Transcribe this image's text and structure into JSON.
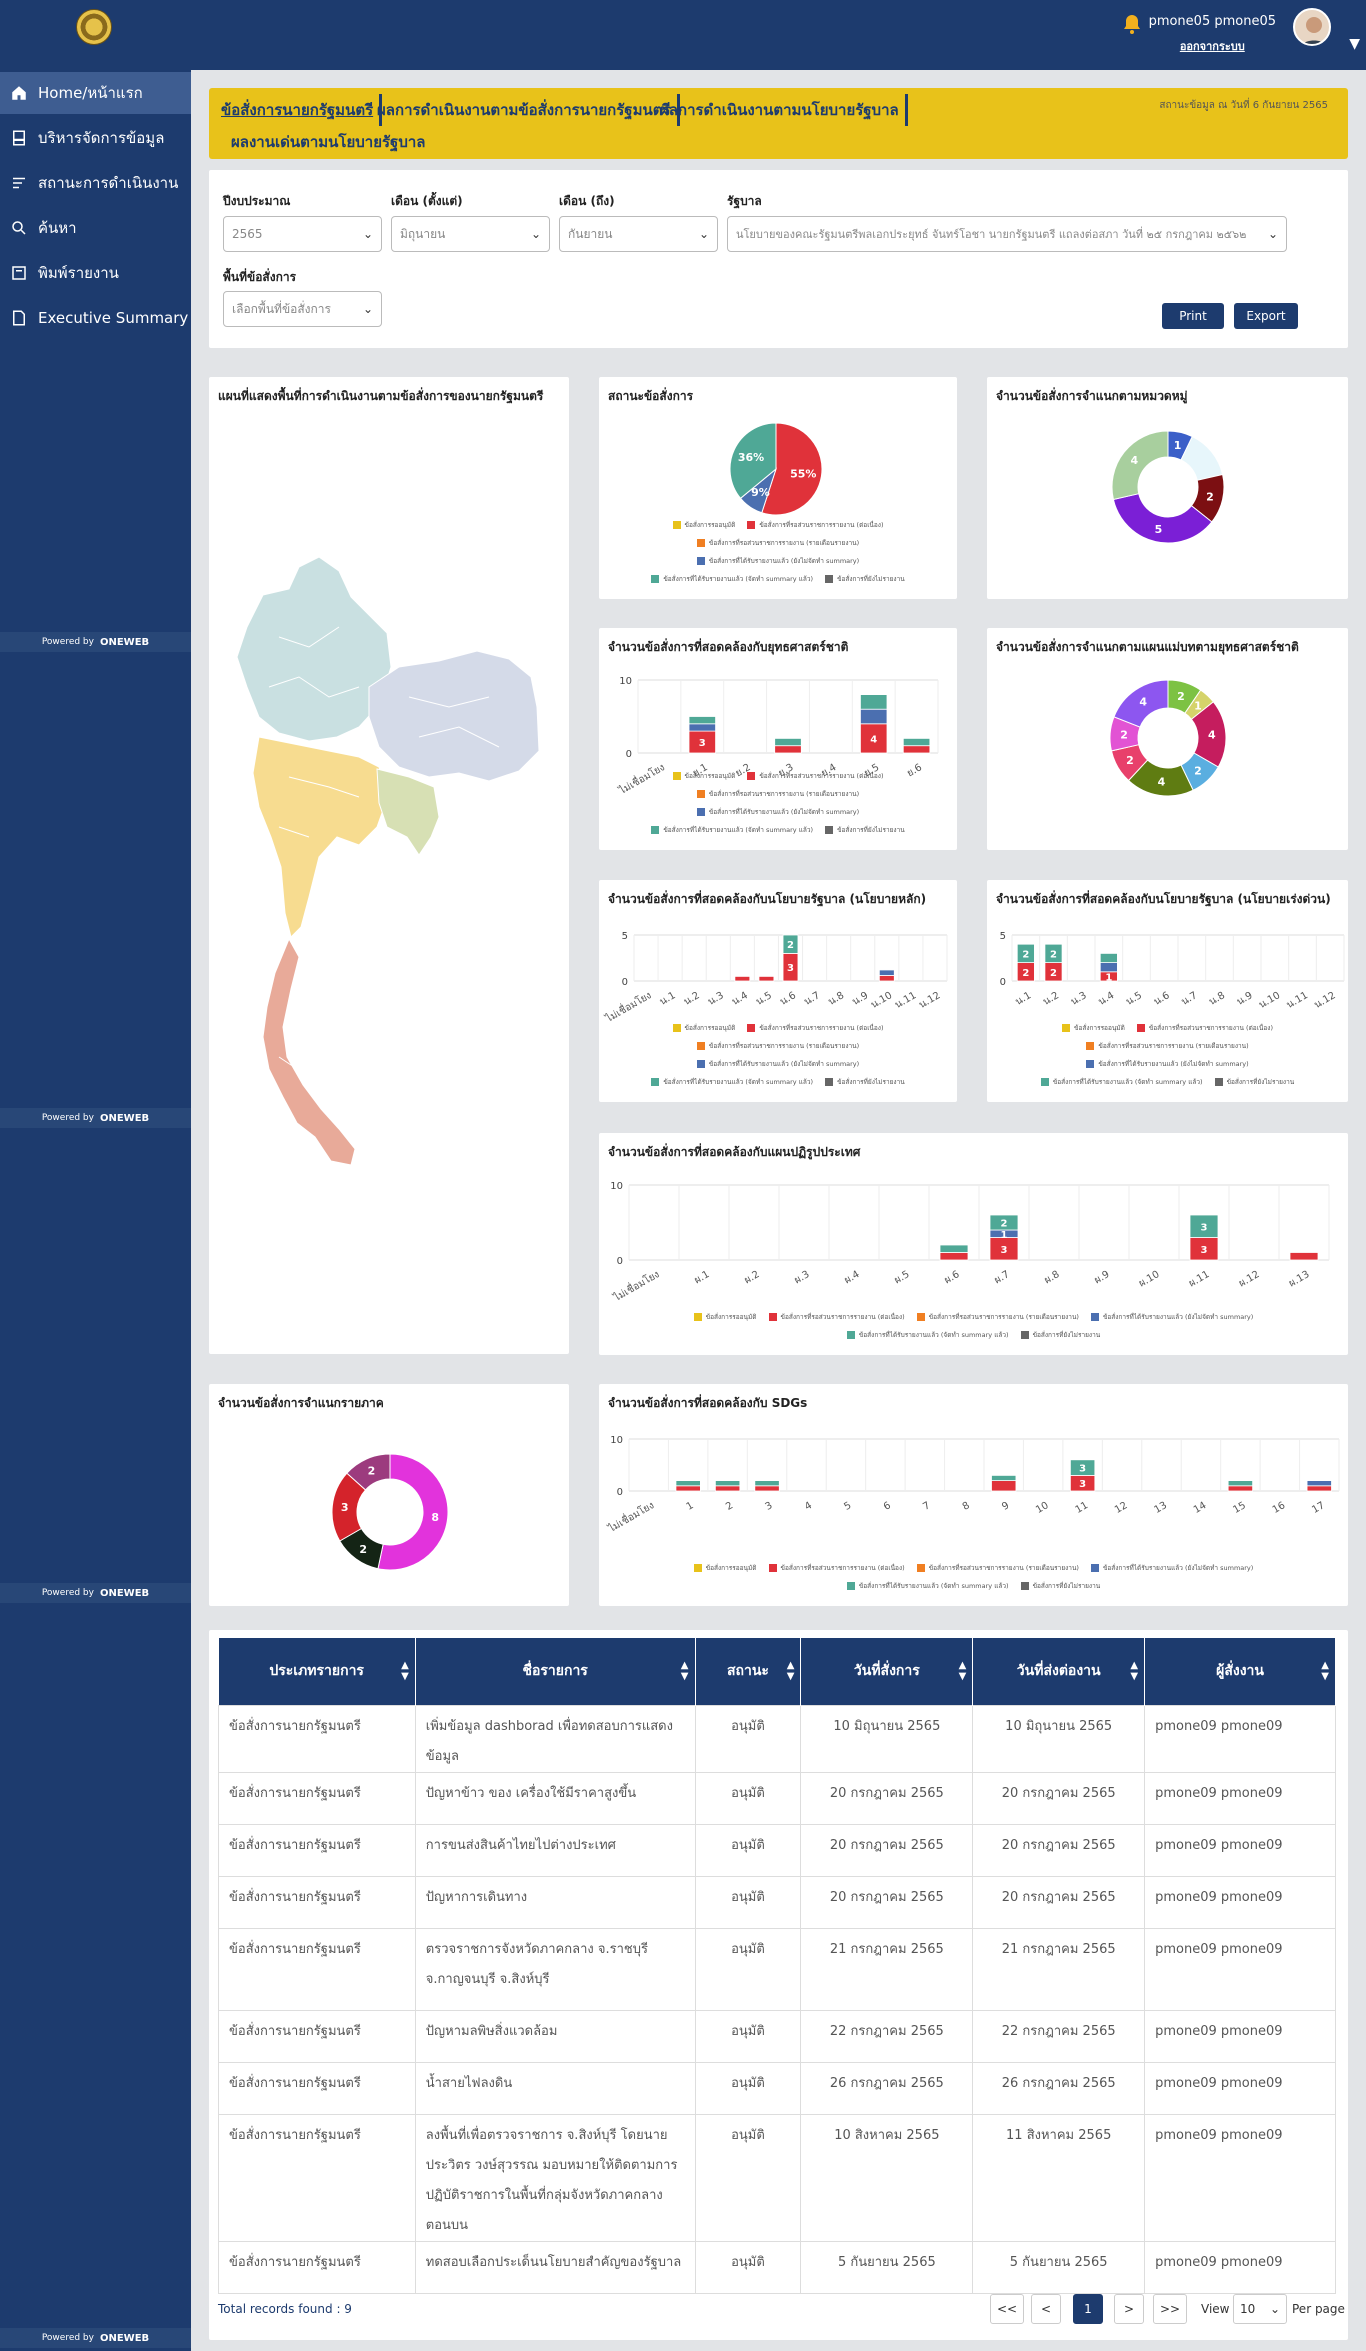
{
  "sidebar": {
    "items": [
      {
        "label": "Home/หน้าแรก",
        "icon": "home-icon"
      },
      {
        "label": "บริหารจัดการข้อมูล",
        "icon": "document-icon"
      },
      {
        "label": "สถานะการดำเนินงาน",
        "icon": "list-icon"
      },
      {
        "label": "ค้นหา",
        "icon": "search-icon"
      },
      {
        "label": "พิมพ์รายงาน",
        "icon": "print-icon"
      },
      {
        "label": "Executive Summary",
        "icon": "report-icon"
      }
    ],
    "powered": "Powered by",
    "brand": "ONEWEB"
  },
  "user": {
    "name": "pmone05 pmone05",
    "logout": "ออกจากระบบ"
  },
  "tabs": [
    "ข้อสั่งการนายกรัฐมนตรี",
    "ผลการดำเนินงานตามข้อสั่งการนายกรัฐมนตรี",
    "ผลการดำเนินงานตามนโยบายรัฐบาล",
    "ผลงานเด่นตามนโยบายรัฐบาล"
  ],
  "updated": "สถานะข้อมูล ณ วันที่ 6 กันยายน 2565",
  "filters": {
    "year_label": "ปีงบประมาณ",
    "year": "2565",
    "from_label": "เดือน (ตั้งแต่)",
    "from": "มิถุนายน",
    "to_label": "เดือน (ถึง)",
    "to": "กันยายน",
    "gov_label": "รัฐบาล",
    "gov": "นโยบายของคณะรัฐมนตรีพลเอกประยุทธ์ จันทร์โอชา นายกรัฐมนตรี แถลงต่อสภา วันที่ ๒๕ กรกฎาคม ๒๕๖๒",
    "area_label": "พื้นที่ข้อสั่งการ",
    "area": "เลือกพื้นที่ข้อสั่งการ",
    "print": "Print",
    "export": "Export"
  },
  "legend": [
    "ข้อสั่งการรออนุมัติ",
    "ข้อสั่งการที่รอส่วนราชการรายงาน (ต่อเนื่อง)",
    "ข้อสั่งการที่รอส่วนราชการรายงาน (รายเดือนรายงาน)",
    "ข้อสั่งการที่ได้รับรายงานแล้ว (ยังไม่จัดทำ summary)",
    "ข้อสั่งการที่ได้รับรายงานแล้ว (จัดทำ summary แล้ว)",
    "ข้อสั่งการที่ยังไม่รายงาน"
  ],
  "colors": {
    "yellow": "#e8c21a",
    "red": "#e0323a",
    "orange": "#f07f22",
    "blue": "#4b6fb0",
    "teal": "#4fa896",
    "grey": "#666666"
  },
  "charts": {
    "map": {
      "title": "แผนที่แสดงพื้นที่การดำเนินงานตามข้อสั่งการของนายกรัฐมนตรี"
    },
    "status": {
      "title": "สถานะข้อสั่งการ",
      "type": "pie",
      "slices": [
        {
          "name": "ข้อสั่งการที่รอส่วนราชการรายงาน (ต่อเนื่อง)",
          "value": 55,
          "label": "55%",
          "color": "#e0323a"
        },
        {
          "name": "ข้อสั่งการที่ได้รับรายงานแล้ว (ยังไม่จัดทำ summary)",
          "value": 9,
          "label": "9%",
          "color": "#4b6fb0"
        },
        {
          "name": "ข้อสั่งการที่ได้รับรายงานแล้ว (จัดทำ summary แล้ว)",
          "value": 36,
          "label": "36%",
          "color": "#4fa896"
        }
      ]
    },
    "category": {
      "title": "จำนวนข้อสั่งการจำแนกตามหมวดหมู่",
      "type": "donut",
      "slices": [
        {
          "value": 1,
          "color": "#3b5fc8",
          "label": "1"
        },
        {
          "value": 2,
          "color": "#e7f6fb",
          "label": ""
        },
        {
          "value": 2,
          "color": "#7c0f12",
          "label": "2"
        },
        {
          "value": 5,
          "color": "#7b1fd6",
          "label": "5"
        },
        {
          "value": 4,
          "color": "#a8cf9e",
          "label": "4"
        }
      ]
    },
    "strategy": {
      "title": "จำนวนข้อสั่งการที่สอดคล้องกับยุทธศาสตร์ชาติ",
      "type": "bar",
      "categories": [
        "ไม่เชื่อมโยง",
        "ย.1",
        "ย.2",
        "ย.3",
        "ย.4",
        "ย.5",
        "ย.6"
      ],
      "ymax": 10,
      "ticks": [
        10,
        0
      ],
      "stacks": [
        [],
        [
          {
            "v": 3,
            "c": "#e0323a",
            "label": "3"
          },
          {
            "v": 1,
            "c": "#4b6fb0"
          },
          {
            "v": 1,
            "c": "#4fa896"
          }
        ],
        [],
        [
          {
            "v": 1,
            "c": "#e0323a"
          },
          {
            "v": 1,
            "c": "#4fa896"
          }
        ],
        [],
        [
          {
            "v": 4,
            "c": "#e0323a",
            "label": "4"
          },
          {
            "v": 2,
            "c": "#4b6fb0"
          },
          {
            "v": 2,
            "c": "#4fa896"
          }
        ],
        [
          {
            "v": 1,
            "c": "#e0323a"
          },
          {
            "v": 1,
            "c": "#4fa896"
          }
        ]
      ]
    },
    "master_plan": {
      "title": "จำนวนข้อสั่งการจำแนกตามแผนแม่บทตามยุทธศาสตร์ชาติ",
      "type": "donut",
      "slices": [
        {
          "value": 2,
          "color": "#7dc243",
          "label": "2"
        },
        {
          "value": 1,
          "color": "#d5d36a",
          "label": "1"
        },
        {
          "value": 4,
          "color": "#c51d5e",
          "label": "4"
        },
        {
          "value": 2,
          "color": "#5aaee0",
          "label": "2"
        },
        {
          "value": 4,
          "color": "#5f7c12",
          "label": "4"
        },
        {
          "value": 2,
          "color": "#e8406b",
          "label": "2"
        },
        {
          "value": 2,
          "color": "#e253d4",
          "label": "2"
        },
        {
          "value": 4,
          "color": "#8d56f0",
          "label": "4"
        }
      ]
    },
    "gov_main": {
      "title": "จำนวนข้อสั่งการที่สอดคล้องกับนโยบายรัฐบาล (นโยบายหลัก)",
      "type": "bar",
      "categories": [
        "ไม่เชื่อมโยง",
        "น.1",
        "น.2",
        "น.3",
        "น.4",
        "น.5",
        "น.6",
        "น.7",
        "น.8",
        "น.9",
        "น.10",
        "น.11",
        "น.12"
      ],
      "ymax": 5,
      "ticks": [
        5,
        0
      ],
      "stacks": [
        [],
        [],
        [],
        [],
        [
          {
            "v": 0.5,
            "c": "#e0323a"
          }
        ],
        [
          {
            "v": 0.5,
            "c": "#e0323a"
          }
        ],
        [
          {
            "v": 3,
            "c": "#e0323a",
            "label": "3"
          },
          {
            "v": 2,
            "c": "#4fa896",
            "label": "2"
          }
        ],
        [],
        [],
        [],
        [
          {
            "v": 0.6,
            "c": "#e0323a"
          },
          {
            "v": 0.6,
            "c": "#4b6fb0"
          }
        ],
        [],
        []
      ]
    },
    "gov_urgent": {
      "title": "จำนวนข้อสั่งการที่สอดคล้องกับนโยบายรัฐบาล (นโยบายเร่งด่วน)",
      "type": "bar",
      "categories": [
        "น.1",
        "น.2",
        "น.3",
        "น.4",
        "น.5",
        "น.6",
        "น.7",
        "น.8",
        "น.9",
        "น.10",
        "น.11",
        "น.12"
      ],
      "ymax": 5,
      "ticks": [
        5,
        0
      ],
      "stacks": [
        [
          {
            "v": 2,
            "c": "#e0323a",
            "label": "2"
          },
          {
            "v": 2,
            "c": "#4fa896",
            "label": "2"
          }
        ],
        [
          {
            "v": 2,
            "c": "#e0323a",
            "label": "2"
          },
          {
            "v": 2,
            "c": "#4fa896",
            "label": "2"
          }
        ],
        [],
        [
          {
            "v": 1,
            "c": "#e0323a",
            "label": "1"
          },
          {
            "v": 1,
            "c": "#4b6fb0"
          },
          {
            "v": 1,
            "c": "#4fa896"
          }
        ],
        [],
        [],
        [],
        [],
        [],
        [],
        [],
        []
      ]
    },
    "reform": {
      "title": "จำนวนข้อสั่งการที่สอดคล้องกับแผนปฏิรูปประเทศ",
      "type": "bar",
      "categories": [
        "ไม่เชื่อมโยง",
        "ผ.1",
        "ผ.2",
        "ผ.3",
        "ผ.4",
        "ผ.5",
        "ผ.6",
        "ผ.7",
        "ผ.8",
        "ผ.9",
        "ผ.10",
        "ผ.11",
        "ผ.12",
        "ผ.13"
      ],
      "ymax": 10,
      "ticks": [
        10,
        0
      ],
      "stacks": [
        [],
        [],
        [],
        [],
        [],
        [],
        [
          {
            "v": 1,
            "c": "#e0323a"
          },
          {
            "v": 1,
            "c": "#4fa896"
          }
        ],
        [
          {
            "v": 3,
            "c": "#e0323a",
            "label": "3"
          },
          {
            "v": 1,
            "c": "#4b6fb0",
            "label": "1"
          },
          {
            "v": 2,
            "c": "#4fa896",
            "label": "2"
          }
        ],
        [],
        [],
        [],
        [
          {
            "v": 3,
            "c": "#e0323a",
            "label": "3"
          },
          {
            "v": 3,
            "c": "#4fa896",
            "label": "3"
          }
        ],
        [],
        [
          {
            "v": 1,
            "c": "#e0323a"
          }
        ]
      ]
    },
    "region": {
      "title": "จำนวนข้อสั่งการจำแนกรายภาค",
      "type": "donut",
      "slices": [
        {
          "value": 8,
          "color": "#e233dc",
          "label": "8"
        },
        {
          "value": 2,
          "color": "#142415",
          "label": "2"
        },
        {
          "value": 3,
          "color": "#d4232b",
          "label": "3"
        },
        {
          "value": 2,
          "color": "#9c3b7e",
          "label": "2"
        }
      ]
    },
    "sdgs": {
      "title": "จำนวนข้อสั่งการที่สอดคล้องกับ SDGs",
      "type": "bar",
      "categories": [
        "ไม่เชื่อมโยง",
        "1",
        "2",
        "3",
        "4",
        "5",
        "6",
        "7",
        "8",
        "9",
        "10",
        "11",
        "12",
        "13",
        "14",
        "15",
        "16",
        "17"
      ],
      "ymax": 10,
      "ticks": [
        10,
        0
      ],
      "stacks": [
        [],
        [
          {
            "v": 1,
            "c": "#e0323a"
          },
          {
            "v": 1,
            "c": "#4fa896"
          }
        ],
        [
          {
            "v": 1,
            "c": "#e0323a"
          },
          {
            "v": 1,
            "c": "#4fa896"
          }
        ],
        [
          {
            "v": 1,
            "c": "#e0323a"
          },
          {
            "v": 1,
            "c": "#4fa896"
          }
        ],
        [],
        [],
        [],
        [],
        [],
        [
          {
            "v": 2,
            "c": "#e0323a"
          },
          {
            "v": 1,
            "c": "#4fa896"
          }
        ],
        [],
        [
          {
            "v": 3,
            "c": "#e0323a",
            "label": "3"
          },
          {
            "v": 3,
            "c": "#4fa896",
            "label": "3"
          }
        ],
        [],
        [],
        [],
        [
          {
            "v": 1,
            "c": "#e0323a"
          },
          {
            "v": 1,
            "c": "#4fa896"
          }
        ],
        [],
        [
          {
            "v": 1,
            "c": "#e0323a"
          },
          {
            "v": 1,
            "c": "#4b6fb0"
          }
        ]
      ]
    }
  },
  "table": {
    "headers": [
      "ประเภทรายการ",
      "ชื่อรายการ",
      "สถานะ",
      "วันที่สั่งการ",
      "วันที่ส่งต่องาน",
      "ผู้สั่งงาน"
    ],
    "rows": [
      [
        "ข้อสั่งการนายกรัฐมนตรี",
        "เพิ่มข้อมูล dashborad เพื่อทดสอบการแสดงข้อมูล",
        "อนุมัติ",
        "10 มิถุนายน 2565",
        "10 มิถุนายน 2565",
        "pmone09 pmone09"
      ],
      [
        "ข้อสั่งการนายกรัฐมนตรี",
        "ปัญหาข้าว ของ เครื่องใช้มีราคาสูงขึ้น",
        "อนุมัติ",
        "20 กรกฎาคม 2565",
        "20 กรกฎาคม 2565",
        "pmone09 pmone09"
      ],
      [
        "ข้อสั่งการนายกรัฐมนตรี",
        "การขนส่งสินค้าไทยไปต่างประเทศ",
        "อนุมัติ",
        "20 กรกฎาคม 2565",
        "20 กรกฎาคม 2565",
        "pmone09 pmone09"
      ],
      [
        "ข้อสั่งการนายกรัฐมนตรี",
        "ปัญหาการเดินทาง",
        "อนุมัติ",
        "20 กรกฎาคม 2565",
        "20 กรกฎาคม 2565",
        "pmone09 pmone09"
      ],
      [
        "ข้อสั่งการนายกรัฐมนตรี",
        "ตรวจราชการจังหวัดภาคกลาง จ.ราชบุรี จ.กาญจนบุรี จ.สิงห์บุรี",
        "อนุมัติ",
        "21 กรกฎาคม 2565",
        "21 กรกฎาคม 2565",
        "pmone09 pmone09"
      ],
      [
        "ข้อสั่งการนายกรัฐมนตรี",
        "ปัญหามลพิษสิ่งแวดล้อม",
        "อนุมัติ",
        "22 กรกฎาคม 2565",
        "22 กรกฎาคม 2565",
        "pmone09 pmone09"
      ],
      [
        "ข้อสั่งการนายกรัฐมนตรี",
        "น้ำสายไฟลงดิน",
        "อนุมัติ",
        "26 กรกฎาคม 2565",
        "26 กรกฎาคม 2565",
        "pmone09 pmone09"
      ],
      [
        "ข้อสั่งการนายกรัฐมนตรี",
        "ลงพื้นที่เพื่อตรวจราชการ จ.สิงห์บุรี โดยนายประวิตร วงษ์สุวรรณ มอบหมายให้ติดตามการปฏิบัติราชการในพื้นที่กลุ่มจังหวัดภาคกลางตอนบน",
        "อนุมัติ",
        "10 สิงหาคม 2565",
        "11 สิงหาคม 2565",
        "pmone09 pmone09"
      ],
      [
        "ข้อสั่งการนายกรัฐมนตรี",
        "ทดสอบเลือกประเด็นนโยบายสำคัญของรัฐบาล",
        "อนุมัติ",
        "5 กันยายน 2565",
        "5 กันยายน 2565",
        "pmone09 pmone09"
      ]
    ],
    "total_label": "Total records found : 9",
    "pager": {
      "first": "<<",
      "prev": "<",
      "current": "1",
      "next": ">",
      "last": ">>",
      "view": "View",
      "per": "10",
      "per_page": "Per page"
    }
  }
}
